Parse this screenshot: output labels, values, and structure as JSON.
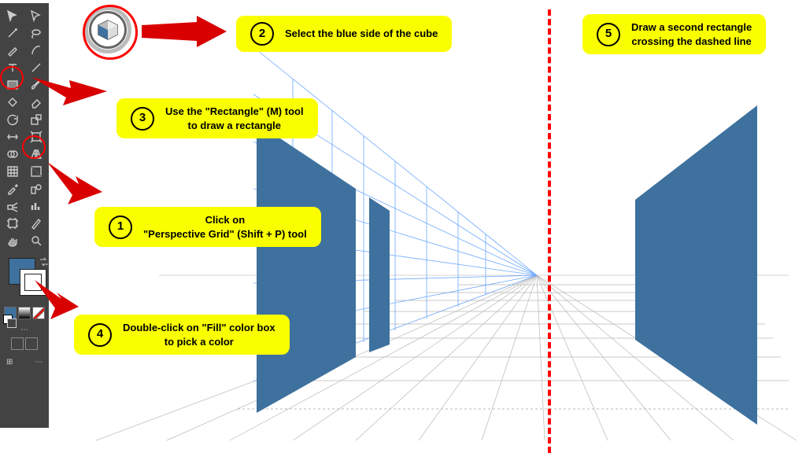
{
  "callouts": {
    "step1": {
      "num": "1",
      "text": "Click on\n\"Perspective Grid\" (Shift + P) tool"
    },
    "step2": {
      "num": "2",
      "text": "Select the blue side of the cube"
    },
    "step3": {
      "num": "3",
      "text": "Use the \"Rectangle\" (M) tool\nto draw a rectangle"
    },
    "step4": {
      "num": "4",
      "text": "Double-click on \"Fill\" color box\nto pick a color"
    },
    "step5": {
      "num": "5",
      "text": "Draw a second rectangle\ncrossing the dashed line"
    }
  },
  "colors": {
    "wall": "#3e719e",
    "callout": "#faff00",
    "grid_blue": "#6da9ff",
    "grid_grey": "#b8b8b8"
  }
}
